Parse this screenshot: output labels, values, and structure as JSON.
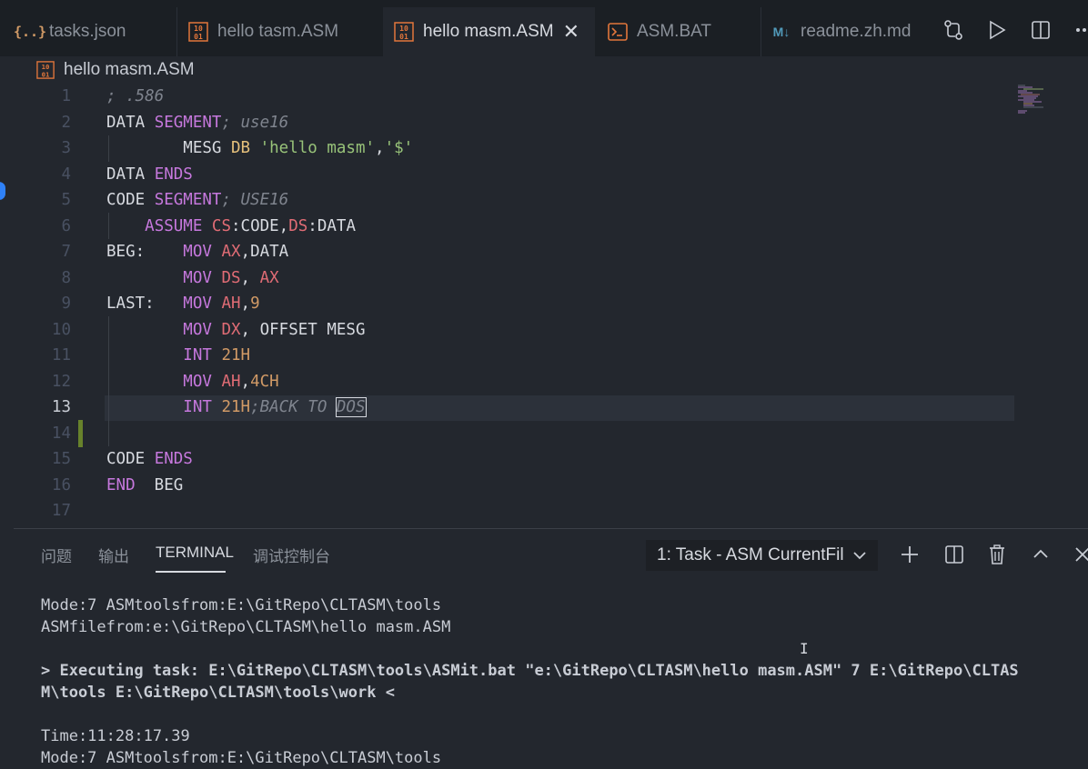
{
  "tabs": [
    {
      "label": "tasks.json",
      "icon": "json-braces-icon",
      "active": false
    },
    {
      "label": "hello tasm.ASM",
      "icon": "binary-file-icon",
      "active": false
    },
    {
      "label": "hello masm.ASM",
      "icon": "binary-file-icon",
      "active": true
    },
    {
      "label": "ASM.BAT",
      "icon": "terminal-file-icon",
      "active": false
    },
    {
      "label": "readme.zh.md",
      "icon": "markdown-icon",
      "active": false
    }
  ],
  "icons": {
    "json": "{..}",
    "binary": "10\n01",
    "markdown": "M↓"
  },
  "breadcrumb": {
    "file": "hello masm.ASM"
  },
  "editor": {
    "line_numbers": [
      "1",
      "2",
      "3",
      "4",
      "5",
      "6",
      "7",
      "8",
      "9",
      "10",
      "11",
      "12",
      "13",
      "14",
      "15",
      "16",
      "17"
    ],
    "lines": [
      [
        {
          "t": "; .586",
          "c": "com"
        }
      ],
      [
        {
          "t": "DATA ",
          "c": "id"
        },
        {
          "t": "SEGMENT",
          "c": "kw"
        },
        {
          "t": "; use16",
          "c": "com"
        }
      ],
      [
        {
          "t": "        MESG ",
          "c": "id"
        },
        {
          "t": "DB",
          "c": "dir"
        },
        {
          "t": " ",
          "c": "id"
        },
        {
          "t": "'hello masm'",
          "c": "str"
        },
        {
          "t": ",",
          "c": "id"
        },
        {
          "t": "'$'",
          "c": "str"
        }
      ],
      [
        {
          "t": "DATA ",
          "c": "id"
        },
        {
          "t": "ENDS",
          "c": "kw"
        }
      ],
      [
        {
          "t": "CODE ",
          "c": "id"
        },
        {
          "t": "SEGMENT",
          "c": "kw"
        },
        {
          "t": "; USE16",
          "c": "com"
        }
      ],
      [
        {
          "t": "    ",
          "c": "id"
        },
        {
          "t": "ASSUME",
          "c": "kw"
        },
        {
          "t": " ",
          "c": "id"
        },
        {
          "t": "CS",
          "c": "reg"
        },
        {
          "t": ":CODE,",
          "c": "id"
        },
        {
          "t": "DS",
          "c": "reg"
        },
        {
          "t": ":DATA",
          "c": "id"
        }
      ],
      [
        {
          "t": "BEG:    ",
          "c": "id"
        },
        {
          "t": "MOV",
          "c": "kw"
        },
        {
          "t": " ",
          "c": "id"
        },
        {
          "t": "AX",
          "c": "reg"
        },
        {
          "t": ",DATA",
          "c": "id"
        }
      ],
      [
        {
          "t": "        ",
          "c": "id"
        },
        {
          "t": "MOV",
          "c": "kw"
        },
        {
          "t": " ",
          "c": "id"
        },
        {
          "t": "DS",
          "c": "reg"
        },
        {
          "t": ", ",
          "c": "id"
        },
        {
          "t": "AX",
          "c": "reg"
        }
      ],
      [
        {
          "t": "LAST:   ",
          "c": "id"
        },
        {
          "t": "MOV",
          "c": "kw"
        },
        {
          "t": " ",
          "c": "id"
        },
        {
          "t": "AH",
          "c": "reg"
        },
        {
          "t": ",",
          "c": "id"
        },
        {
          "t": "9",
          "c": "num"
        }
      ],
      [
        {
          "t": "        ",
          "c": "id"
        },
        {
          "t": "MOV",
          "c": "kw"
        },
        {
          "t": " ",
          "c": "id"
        },
        {
          "t": "DX",
          "c": "reg"
        },
        {
          "t": ", OFFSET MESG",
          "c": "id"
        }
      ],
      [
        {
          "t": "        ",
          "c": "id"
        },
        {
          "t": "INT",
          "c": "kw"
        },
        {
          "t": " ",
          "c": "id"
        },
        {
          "t": "21H",
          "c": "num"
        }
      ],
      [
        {
          "t": "        ",
          "c": "id"
        },
        {
          "t": "MOV",
          "c": "kw"
        },
        {
          "t": " ",
          "c": "id"
        },
        {
          "t": "AH",
          "c": "reg"
        },
        {
          "t": ",",
          "c": "id"
        },
        {
          "t": "4CH",
          "c": "num"
        }
      ],
      [
        {
          "t": "        ",
          "c": "id"
        },
        {
          "t": "INT",
          "c": "kw"
        },
        {
          "t": " ",
          "c": "id"
        },
        {
          "t": "21H",
          "c": "num"
        },
        {
          "t": ";BACK TO ",
          "c": "com"
        },
        {
          "t": "DOS",
          "c": "com",
          "sel": true
        }
      ],
      [],
      [
        {
          "t": "CODE ",
          "c": "id"
        },
        {
          "t": "ENDS",
          "c": "kw"
        }
      ],
      [
        {
          "t": "END",
          "c": "kw"
        },
        {
          "t": "  BEG",
          "c": "id"
        }
      ],
      []
    ]
  },
  "panel": {
    "tabs": [
      "问题",
      "输出",
      "TERMINAL",
      "调试控制台"
    ],
    "active_tab": "TERMINAL",
    "task_select": "1: Task - ASM CurrentFil",
    "terminal_lines": [
      {
        "t": "Mode:7 ASMtoolsfrom:E:\\GitRepo\\CLTASM\\tools",
        "b": false
      },
      {
        "t": "ASMfilefrom:e:\\GitRepo\\CLTASM\\hello masm.ASM",
        "b": false
      },
      {
        "t": "",
        "b": false
      },
      {
        "t": "> Executing task: E:\\GitRepo\\CLTASM\\tools\\ASMit.bat \"e:\\GitRepo\\CLTASM\\hello masm.ASM\" 7 E:\\GitRepo\\CLTAS",
        "b": true
      },
      {
        "t": "M\\tools E:\\GitRepo\\CLTASM\\tools\\work <",
        "b": true
      },
      {
        "t": "",
        "b": false
      },
      {
        "t": "Time:11:28:17.39",
        "b": false
      },
      {
        "t": "Mode:7 ASMtoolsfrom:E:\\GitRepo\\CLTASM\\tools",
        "b": false
      }
    ]
  },
  "colors": {
    "keyword": "#c678dd",
    "register": "#e06c75",
    "number": "#d19a66",
    "string": "#98c379",
    "comment": "#7f848e",
    "directive": "#e5c07b",
    "asm_icon": "#e2763b",
    "markdown_icon": "#519aba",
    "json_icon": "#d19a66"
  }
}
